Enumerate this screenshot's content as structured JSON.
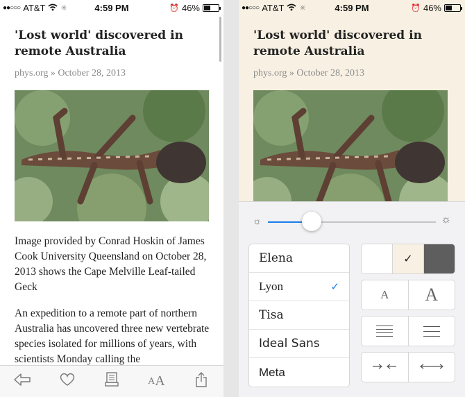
{
  "status_bar": {
    "signal": "●●○○○",
    "carrier": "AT&T",
    "time": "4:59 PM",
    "battery": "46%",
    "battery_level": 0.46
  },
  "article": {
    "title": "'Lost world' discovered in remote Australia",
    "source": "phys.org",
    "separator": "»",
    "date": "October 28, 2013",
    "caption": "Image provided by Conrad Hoskin of James Cook University Queensland on October 28, 2013 shows the Cape Melville Leaf-tailed Geck",
    "paragraph": "An expedition to a remote part of northern Australia has uncovered three new vertebrate species isolated for millions of years, with scientists Monday calling the"
  },
  "toolbar": {
    "back_icon": "back-arrow-icon",
    "like_icon": "heart-icon",
    "archive_icon": "archive-icon",
    "font_small": "A",
    "font_large": "A",
    "share_icon": "share-icon"
  },
  "settings": {
    "brightness": 0.26,
    "fonts": [
      {
        "label": "Elena",
        "selected": false
      },
      {
        "label": "Lyon",
        "selected": true
      },
      {
        "label": "Tisa",
        "selected": false
      },
      {
        "label": "Ideal Sans",
        "selected": false
      },
      {
        "label": "Meta",
        "selected": false
      }
    ],
    "check_mark": "✓",
    "theme_check": "✓",
    "size_small": "A",
    "size_large": "A"
  },
  "colors": {
    "accent": "#1a7de8",
    "sepia": "#f8f1e3"
  }
}
